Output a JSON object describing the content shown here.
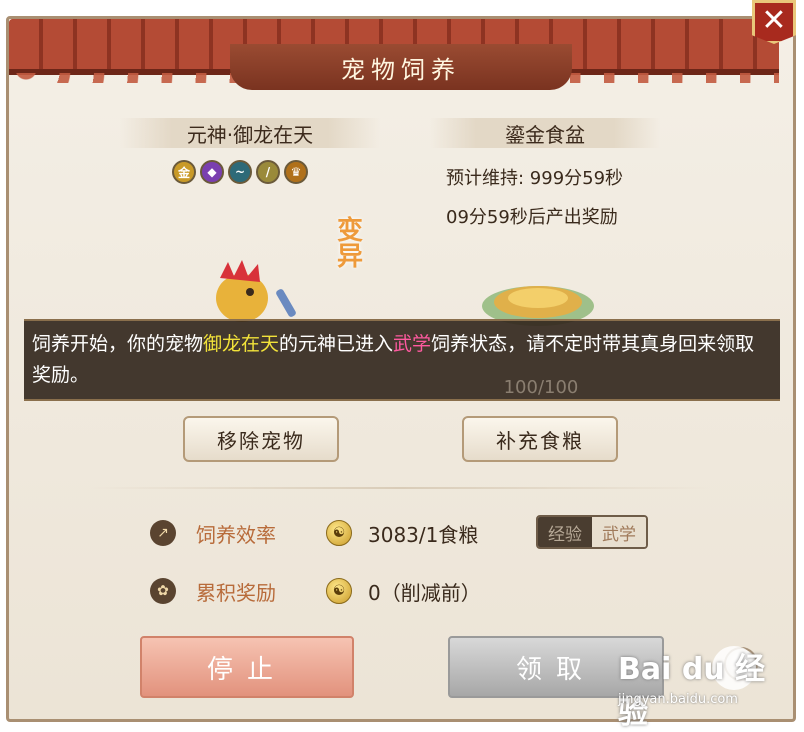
{
  "window": {
    "title": "宠物饲养",
    "close_label": "✕"
  },
  "pet": {
    "name": "元神·御龙在天",
    "elements": [
      {
        "glyph": "金",
        "color": "#c99a28",
        "icon": "gold-element-icon"
      },
      {
        "glyph": "◆",
        "color": "#7a3fb0",
        "icon": "purple-gem-icon"
      },
      {
        "glyph": "~",
        "color": "#2e6a78",
        "icon": "water-element-icon"
      },
      {
        "glyph": "/",
        "color": "#9a8a3a",
        "icon": "wood-element-icon"
      },
      {
        "glyph": "♛",
        "color": "#b0701a",
        "icon": "crown-icon"
      }
    ],
    "mutation_label": "变异"
  },
  "food": {
    "name": "鎏金食盆",
    "duration": "预计维持: 999分59秒",
    "reward_countdown": "09分59秒后产出奖励",
    "capacity": "100/100"
  },
  "notice": {
    "prefix": "饲养开始，你的宠物",
    "pet_name": "御龙在天",
    "middle": "的元神已进入",
    "mode": "武学",
    "suffix": "饲养状态，请不定时带其真身回来领取奖励。"
  },
  "actions": {
    "remove_pet": "移除宠物",
    "add_food": "补充食粮",
    "stop": "停止",
    "claim": "领取"
  },
  "stats": {
    "efficiency_label": "饲养效率",
    "efficiency_value": "3083/1食粮",
    "accumulated_label": "累积奖励",
    "accumulated_value": "0（削减前）",
    "mode_toggle": {
      "option_exp": "经验",
      "option_wuxue": "武学",
      "selected": "武学"
    }
  },
  "watermark": {
    "logo": "Bai du 经验",
    "site": "jingyan.baidu.com"
  }
}
